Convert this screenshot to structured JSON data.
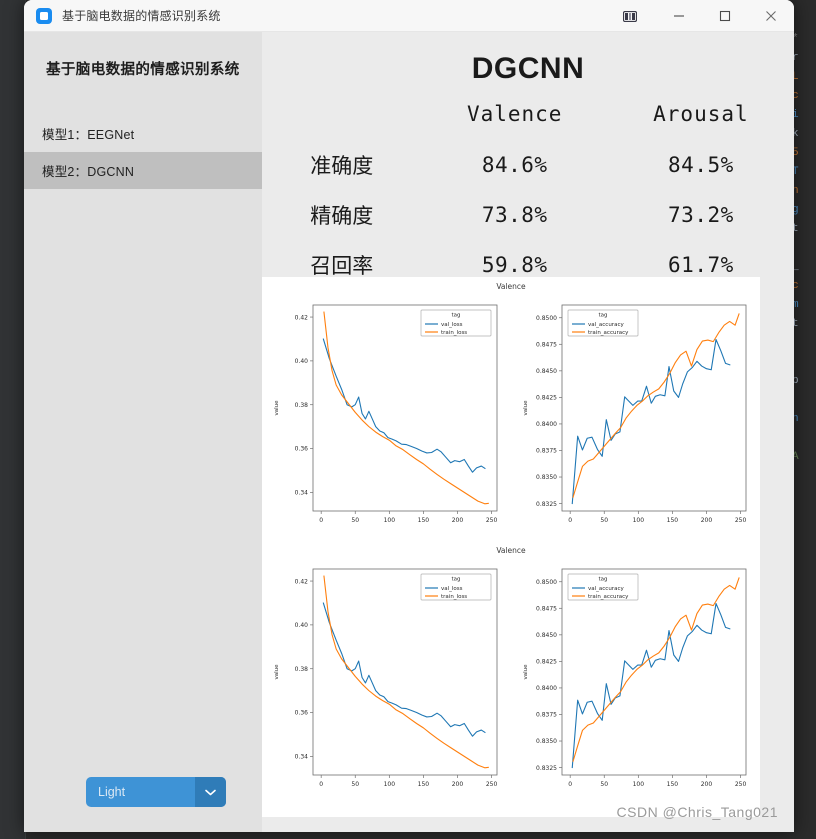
{
  "window": {
    "title": "基于脑电数据的情感识别系统",
    "icon": "app-square-icon",
    "controls": {
      "snap": "snap-layouts-icon",
      "minimize": "minimize-icon",
      "maximize": "maximize-icon",
      "close": "close-icon"
    }
  },
  "sidebar": {
    "title": "基于脑电数据的情感识别系统",
    "items": [
      {
        "label": "模型1：EEGNet",
        "selected": false
      },
      {
        "label": "模型2：DGCNN",
        "selected": true
      }
    ],
    "theme_select": {
      "value": "Light",
      "arrow_icon": "chevron-down-icon",
      "accent": "#3e93d6"
    }
  },
  "main": {
    "model_title": "DGCNN",
    "metrics": {
      "corner": "",
      "columns": [
        "Valence",
        "Arousal"
      ],
      "rows": [
        {
          "label": "准确度",
          "values": [
            "84.6%",
            "84.5%"
          ]
        },
        {
          "label": "精确度",
          "values": [
            "73.8%",
            "73.2%"
          ]
        },
        {
          "label": "召回率",
          "values": [
            "59.8%",
            "61.7%"
          ]
        }
      ]
    }
  },
  "watermark": "CSDN @Chris_Tang021",
  "chart_data": [
    {
      "id": "valence-loss-top",
      "group_caption": "Valence",
      "type": "line",
      "title": "",
      "xlabel": "",
      "ylabel": "value",
      "xlim": [
        -12,
        258
      ],
      "ylim": [
        0.3315,
        0.4255
      ],
      "xticks": [
        0,
        50,
        100,
        150,
        200,
        250
      ],
      "yticks": [
        0.34,
        0.36,
        0.38,
        0.4,
        0.42
      ],
      "ytick_labels": [
        "0.34",
        "0.36",
        "0.38",
        "0.40",
        "0.42"
      ],
      "grid": false,
      "legend": {
        "title": "tag",
        "position": "upper right"
      },
      "series": [
        {
          "name": "val_loss",
          "color": "#1f77b4",
          "x": [
            3,
            12,
            22,
            30,
            38,
            45,
            50,
            55,
            60,
            65,
            70,
            75,
            80,
            86,
            92,
            98,
            104,
            110,
            118,
            125,
            132,
            140,
            148,
            155,
            162,
            170,
            176,
            183,
            190,
            196,
            203,
            210,
            216,
            222,
            228,
            235,
            241
          ],
          "y": [
            0.4102,
            0.401,
            0.393,
            0.387,
            0.38,
            0.379,
            0.38,
            0.3835,
            0.376,
            0.3735,
            0.377,
            0.3735,
            0.37,
            0.368,
            0.3672,
            0.365,
            0.3643,
            0.3635,
            0.362,
            0.3618,
            0.361,
            0.36,
            0.3588,
            0.358,
            0.3582,
            0.3597,
            0.3585,
            0.356,
            0.3535,
            0.3545,
            0.354,
            0.355,
            0.352,
            0.3492,
            0.3512,
            0.352,
            0.3508
          ]
        },
        {
          "name": "train_loss",
          "color": "#ff7f0e",
          "x": [
            4,
            10,
            16,
            22,
            30,
            40,
            50,
            60,
            70,
            80,
            90,
            100,
            110,
            120,
            130,
            140,
            150,
            160,
            170,
            180,
            190,
            200,
            210,
            220,
            230,
            240,
            246
          ],
          "y": [
            0.4225,
            0.406,
            0.3955,
            0.389,
            0.3845,
            0.3805,
            0.3765,
            0.373,
            0.37,
            0.3675,
            0.3655,
            0.3638,
            0.3612,
            0.3595,
            0.3572,
            0.355,
            0.353,
            0.3505,
            0.3482,
            0.346,
            0.344,
            0.342,
            0.34,
            0.338,
            0.336,
            0.3348,
            0.335
          ]
        }
      ]
    },
    {
      "id": "valence-accuracy-top",
      "group_caption": "Valence",
      "type": "line",
      "title": "",
      "xlabel": "",
      "ylabel": "value",
      "xlim": [
        -12,
        258
      ],
      "ylim": [
        0.8318,
        0.8512
      ],
      "xticks": [
        0,
        50,
        100,
        150,
        200,
        250
      ],
      "yticks": [
        0.8325,
        0.835,
        0.8375,
        0.84,
        0.8425,
        0.845,
        0.8475,
        0.85
      ],
      "ytick_labels": [
        "0.8325",
        "0.8350",
        "0.8375",
        "0.8400",
        "0.8425",
        "0.8450",
        "0.8475",
        "0.8500"
      ],
      "grid": false,
      "legend": {
        "title": "tag",
        "position": "upper left"
      },
      "series": [
        {
          "name": "val_accuracy",
          "color": "#1f77b4",
          "x": [
            3,
            11,
            18,
            25,
            32,
            40,
            47,
            53,
            60,
            66,
            73,
            80,
            86,
            92,
            99,
            105,
            112,
            119,
            125,
            132,
            139,
            145,
            152,
            159,
            165,
            172,
            179,
            186,
            193,
            200,
            207,
            214,
            221,
            228,
            235,
            242,
            247
          ],
          "y": [
            0.83245,
            0.83885,
            0.83755,
            0.83865,
            0.83875,
            0.8376,
            0.83695,
            0.8404,
            0.83845,
            0.83905,
            0.83925,
            0.84255,
            0.84215,
            0.84175,
            0.84215,
            0.84215,
            0.84355,
            0.84195,
            0.8426,
            0.84275,
            0.84265,
            0.8454,
            0.8431,
            0.8425,
            0.84375,
            0.8449,
            0.8453,
            0.8459,
            0.84545,
            0.8452,
            0.8451,
            0.84795,
            0.8469,
            0.8457,
            0.84555
          ]
        },
        {
          "name": "train_accuracy",
          "color": "#ff7f0e",
          "x": [
            4,
            11,
            18,
            26,
            34,
            42,
            50,
            58,
            66,
            74,
            82,
            90,
            98,
            106,
            114,
            122,
            130,
            138,
            146,
            154,
            162,
            170,
            178,
            186,
            194,
            202,
            210,
            218,
            226,
            234,
            242,
            248
          ],
          "y": [
            0.83305,
            0.83455,
            0.836,
            0.8365,
            0.8367,
            0.8373,
            0.8379,
            0.8385,
            0.8391,
            0.83965,
            0.84055,
            0.8412,
            0.84175,
            0.84215,
            0.84265,
            0.843,
            0.8433,
            0.84395,
            0.84475,
            0.84575,
            0.8465,
            0.84685,
            0.84545,
            0.847,
            0.8478,
            0.8479,
            0.84775,
            0.8486,
            0.8493,
            0.84965,
            0.8493,
            0.8504
          ]
        }
      ]
    },
    {
      "id": "valence-loss-bottom",
      "group_caption": "Valence",
      "type": "line",
      "title": "",
      "xlabel": "",
      "ylabel": "value",
      "xlim": [
        -12,
        258
      ],
      "ylim": [
        0.3315,
        0.4255
      ],
      "xticks": [
        0,
        50,
        100,
        150,
        200,
        250
      ],
      "yticks": [
        0.34,
        0.36,
        0.38,
        0.4,
        0.42
      ],
      "ytick_labels": [
        "0.34",
        "0.36",
        "0.38",
        "0.40",
        "0.42"
      ],
      "grid": false,
      "legend": {
        "title": "tag",
        "position": "upper right"
      },
      "series": [
        {
          "name": "val_loss",
          "color": "#1f77b4",
          "x": [
            3,
            12,
            22,
            30,
            38,
            45,
            50,
            55,
            60,
            65,
            70,
            75,
            80,
            86,
            92,
            98,
            104,
            110,
            118,
            125,
            132,
            140,
            148,
            155,
            162,
            170,
            176,
            183,
            190,
            196,
            203,
            210,
            216,
            222,
            228,
            235,
            241
          ],
          "y": [
            0.4102,
            0.401,
            0.393,
            0.387,
            0.38,
            0.379,
            0.38,
            0.3835,
            0.376,
            0.3735,
            0.377,
            0.3735,
            0.37,
            0.368,
            0.3672,
            0.365,
            0.3643,
            0.3635,
            0.362,
            0.3618,
            0.361,
            0.36,
            0.3588,
            0.358,
            0.3582,
            0.3597,
            0.3585,
            0.356,
            0.3535,
            0.3545,
            0.354,
            0.355,
            0.352,
            0.3492,
            0.3512,
            0.352,
            0.3508
          ]
        },
        {
          "name": "train_loss",
          "color": "#ff7f0e",
          "x": [
            4,
            10,
            16,
            22,
            30,
            40,
            50,
            60,
            70,
            80,
            90,
            100,
            110,
            120,
            130,
            140,
            150,
            160,
            170,
            180,
            190,
            200,
            210,
            220,
            230,
            240,
            246
          ],
          "y": [
            0.4225,
            0.406,
            0.3955,
            0.389,
            0.3845,
            0.3805,
            0.3765,
            0.373,
            0.37,
            0.3675,
            0.3655,
            0.3638,
            0.3612,
            0.3595,
            0.3572,
            0.355,
            0.353,
            0.3505,
            0.3482,
            0.346,
            0.344,
            0.342,
            0.34,
            0.338,
            0.336,
            0.3348,
            0.335
          ]
        }
      ]
    },
    {
      "id": "valence-accuracy-bottom",
      "group_caption": "Valence",
      "type": "line",
      "title": "",
      "xlabel": "",
      "ylabel": "value",
      "xlim": [
        -12,
        258
      ],
      "ylim": [
        0.8318,
        0.8512
      ],
      "xticks": [
        0,
        50,
        100,
        150,
        200,
        250
      ],
      "yticks": [
        0.8325,
        0.835,
        0.8375,
        0.84,
        0.8425,
        0.845,
        0.8475,
        0.85
      ],
      "ytick_labels": [
        "0.8325",
        "0.8350",
        "0.8375",
        "0.8400",
        "0.8425",
        "0.8450",
        "0.8475",
        "0.8500"
      ],
      "grid": false,
      "legend": {
        "title": "tag",
        "position": "upper left"
      },
      "series": [
        {
          "name": "val_accuracy",
          "color": "#1f77b4",
          "x": [
            3,
            11,
            18,
            25,
            32,
            40,
            47,
            53,
            60,
            66,
            73,
            80,
            86,
            92,
            99,
            105,
            112,
            119,
            125,
            132,
            139,
            145,
            152,
            159,
            165,
            172,
            179,
            186,
            193,
            200,
            207,
            214,
            221,
            228,
            235,
            242,
            247
          ],
          "y": [
            0.83245,
            0.83885,
            0.83755,
            0.83865,
            0.83875,
            0.8376,
            0.83695,
            0.8404,
            0.83845,
            0.83905,
            0.83925,
            0.84255,
            0.84215,
            0.84175,
            0.84215,
            0.84215,
            0.84355,
            0.84195,
            0.8426,
            0.84275,
            0.84265,
            0.8454,
            0.8431,
            0.8425,
            0.84375,
            0.8449,
            0.8453,
            0.8459,
            0.84545,
            0.8452,
            0.8451,
            0.84795,
            0.8469,
            0.8457,
            0.84555
          ]
        },
        {
          "name": "train_accuracy",
          "color": "#ff7f0e",
          "x": [
            4,
            11,
            18,
            26,
            34,
            42,
            50,
            58,
            66,
            74,
            82,
            90,
            98,
            106,
            114,
            122,
            130,
            138,
            146,
            154,
            162,
            170,
            178,
            186,
            194,
            202,
            210,
            218,
            226,
            234,
            242,
            248
          ],
          "y": [
            0.83305,
            0.83455,
            0.836,
            0.8365,
            0.8367,
            0.8373,
            0.8379,
            0.8385,
            0.8391,
            0.83965,
            0.84055,
            0.8412,
            0.84175,
            0.84215,
            0.84265,
            0.843,
            0.8433,
            0.84395,
            0.84475,
            0.84575,
            0.8465,
            0.84685,
            0.84545,
            0.847,
            0.8478,
            0.8479,
            0.84775,
            0.8486,
            0.8493,
            0.84965,
            0.8493,
            0.8504
          ]
        }
      ]
    }
  ]
}
